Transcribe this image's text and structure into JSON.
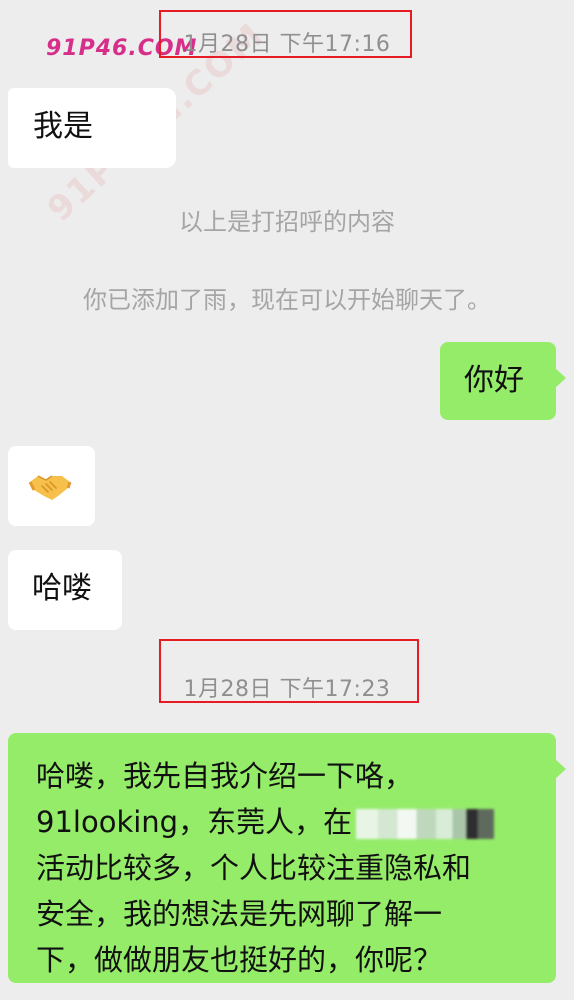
{
  "watermarks": {
    "primary": "91P46.COM",
    "secondary": "91PORN.COM"
  },
  "timestamps": [
    "1月28日 下午17:16",
    "1月28日 下午17:23"
  ],
  "system_notices": {
    "greeting_note": "以上是打招呼的内容",
    "friend_added": "你已添加了雨，现在可以开始聊天了。"
  },
  "messages": {
    "m1": "我是",
    "m2": "你好",
    "m3_emoji": "handshake-emoji",
    "m4": "哈喽",
    "m5": {
      "line1": "哈喽，我先自我介绍一下咯，",
      "line2_a": "91looking，东莞人，在",
      "line3": "活动比较多，个人比较注重隐私和",
      "line4": "安全，我的想法是先网聊了解一",
      "line5": "下，做做朋友也挺好的，你呢？"
    }
  },
  "colors": {
    "background": "#ededed",
    "incoming_bubble": "#ffffff",
    "outgoing_bubble": "#95ec69",
    "highlight_box": "#e51c23",
    "watermark": "#d62f8a"
  }
}
